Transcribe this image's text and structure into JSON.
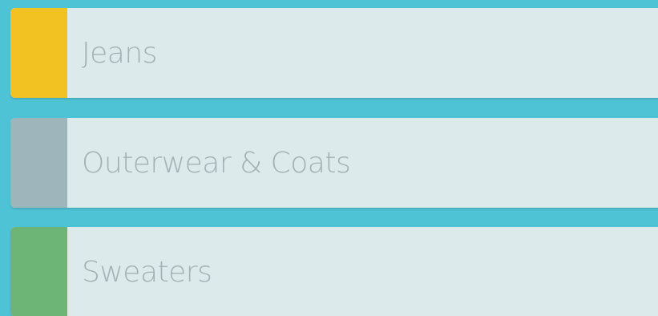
{
  "categories": [
    {
      "label": "Jeans",
      "color": "#f2c222"
    },
    {
      "label": "Outerwear & Coats",
      "color": "#9fb5bc"
    },
    {
      "label": "Sweaters",
      "color": "#6db577"
    }
  ]
}
